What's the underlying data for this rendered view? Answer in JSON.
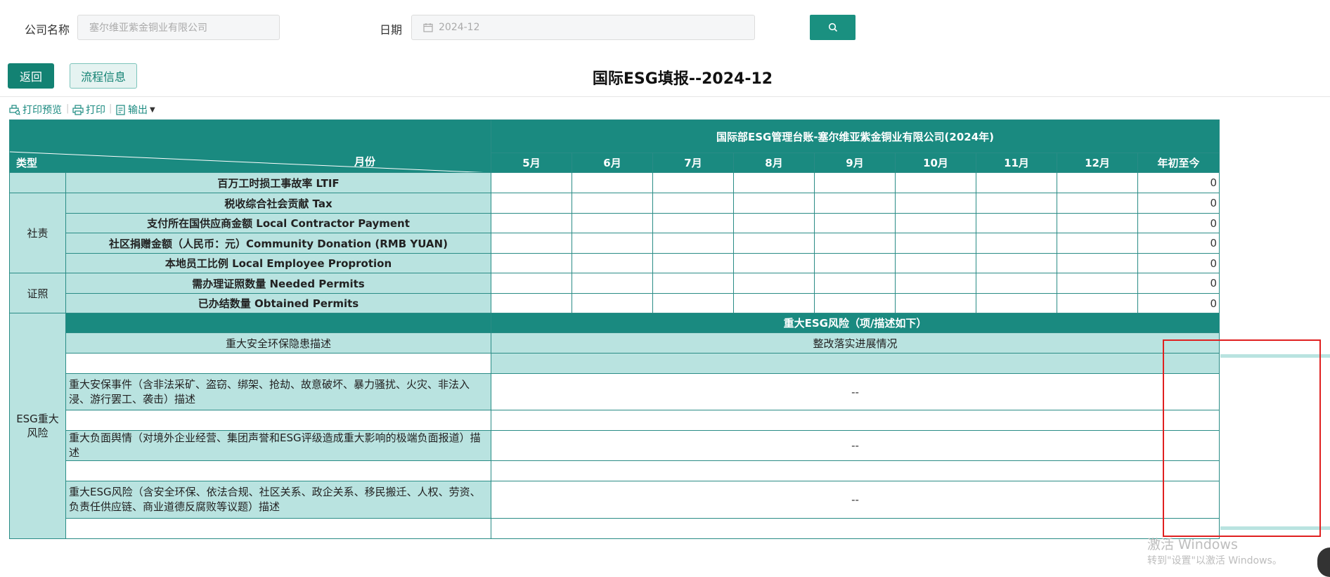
{
  "search": {
    "company_label": "公司名称",
    "company_value": "塞尔维亚紫金铜业有限公司",
    "date_label": "日期",
    "date_value": "2024-12"
  },
  "actions": {
    "back_label": "返回",
    "flow_label": "流程信息"
  },
  "page_title": "国际ESG填报--2024-12",
  "toolbar": {
    "print_preview": "打印预览",
    "print": "打印",
    "export": "输出"
  },
  "table": {
    "main_header": "国际部ESG管理台账-塞尔维亚紫金铜业有限公司(2024年)",
    "corner_type": "类型",
    "corner_month": "月份",
    "months": [
      "5月",
      "6月",
      "7月",
      "8月",
      "9月",
      "10月",
      "11月",
      "12月",
      "年初至今"
    ],
    "groups": {
      "social": "社责",
      "permits": "证照",
      "esg_risk": "ESG重大风险"
    },
    "metrics": [
      {
        "name": "百万工时损工事故率 LTIF",
        "ytd": "0"
      },
      {
        "name": "税收综合社会贡献 Tax",
        "ytd": "0"
      },
      {
        "name": "支付所在国供应商金额 Local Contractor Payment",
        "ytd": "0"
      },
      {
        "name": "社区捐赠金额（人民币：元）Community Donation (RMB YUAN)",
        "ytd": "0"
      },
      {
        "name": "本地员工比例 Local Employee Proprotion",
        "ytd": "0"
      },
      {
        "name": "需办理证照数量 Needed Permits",
        "ytd": "0"
      },
      {
        "name": "已办结数量 Obtained Permits",
        "ytd": "0"
      }
    ],
    "risk_header": "重大ESG风险（项/描述如下）",
    "risk_col_desc": "重大安全环保隐患描述",
    "risk_col_progress": "整改落实进展情况",
    "risk_items": [
      {
        "desc": "重大安保事件（含非法采矿、盗窃、绑架、抢劫、故意破坏、暴力骚扰、火灾、非法入浸、游行罢工、袭击）描述",
        "value": "--"
      },
      {
        "desc": "重大负面舆情（对境外企业经营、集团声誉和ESG评级造成重大影响的极端负面报道）描述",
        "value": "--"
      },
      {
        "desc": "重大ESG风险（含安全环保、依法合规、社区关系、政企关系、移民搬迁、人权、劳资、负责任供应链、商业道德反腐败等议题）描述",
        "value": "--"
      }
    ]
  },
  "watermark": {
    "line1": "激活 Windows",
    "line2": "转到\"设置\"以激活 Windows。"
  },
  "colors": {
    "header_teal": "#1a8a80",
    "light_teal": "#b9e3e0",
    "highlight_red": "#e02020"
  }
}
